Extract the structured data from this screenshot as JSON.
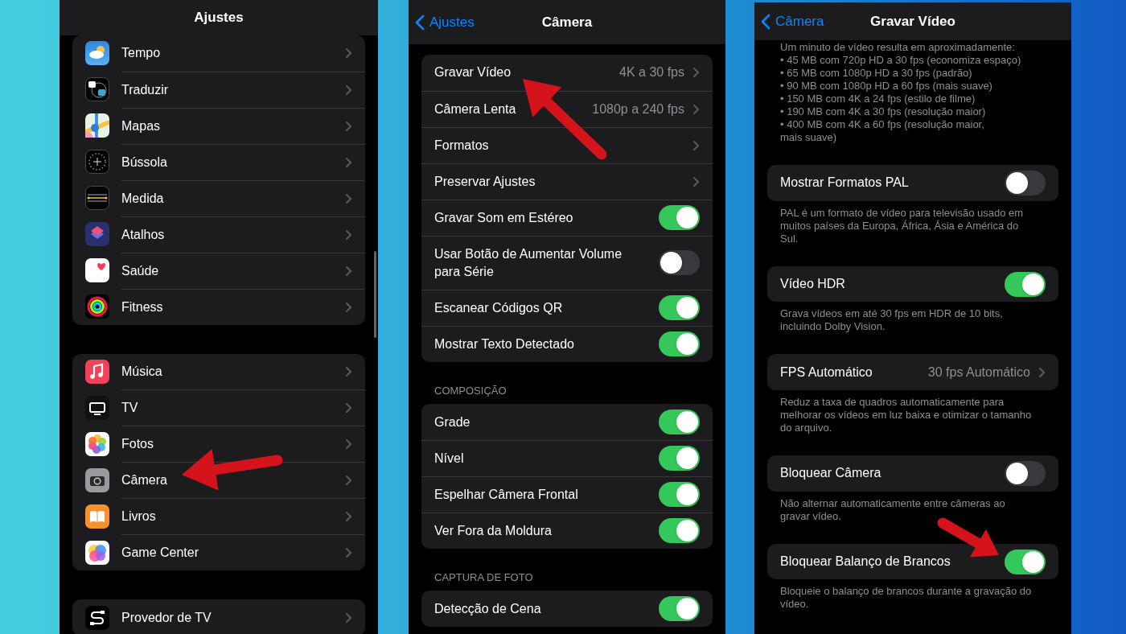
{
  "panels": [
    {
      "title": "Ajustes",
      "groups": [
        {
          "items": [
            {
              "kind": "link",
              "label": "Tempo"
            },
            {
              "kind": "link",
              "label": "Traduzir"
            },
            {
              "kind": "link",
              "label": "Mapas"
            },
            {
              "kind": "link",
              "label": "Bússola"
            },
            {
              "kind": "link",
              "label": "Medida"
            },
            {
              "kind": "link",
              "label": "Atalhos"
            },
            {
              "kind": "link",
              "label": "Saúde"
            },
            {
              "kind": "link",
              "label": "Fitness"
            }
          ]
        },
        {
          "items": [
            {
              "kind": "link",
              "label": "Música"
            },
            {
              "kind": "link",
              "label": "TV"
            },
            {
              "kind": "link",
              "label": "Fotos"
            },
            {
              "kind": "link",
              "label": "Câmera"
            },
            {
              "kind": "link",
              "label": "Livros"
            },
            {
              "kind": "link",
              "label": "Game Center"
            }
          ]
        },
        {
          "items": [
            {
              "kind": "link",
              "label": "Provedor de TV"
            }
          ]
        }
      ]
    },
    {
      "back": "Ajustes",
      "title": "Câmera",
      "groups": [
        {
          "items": [
            {
              "kind": "link",
              "label": "Gravar Vídeo",
              "value": "4K a 30 fps"
            },
            {
              "kind": "link",
              "label": "Câmera Lenta",
              "value": "1080p a 240 fps"
            },
            {
              "kind": "link",
              "label": "Formatos"
            },
            {
              "kind": "link",
              "label": "Preservar Ajustes"
            },
            {
              "kind": "toggle",
              "label": "Gravar Som em Estéreo",
              "on": true
            },
            {
              "kind": "toggle",
              "label": "Usar Botão de Aumentar Volume para Série",
              "on": false
            },
            {
              "kind": "toggle",
              "label": "Escanear Códigos QR",
              "on": true
            },
            {
              "kind": "toggle",
              "label": "Mostrar Texto Detectado",
              "on": true
            }
          ]
        },
        {
          "header": "COMPOSIÇÃO",
          "items": [
            {
              "kind": "toggle",
              "label": "Grade",
              "on": true
            },
            {
              "kind": "toggle",
              "label": "Nível",
              "on": true
            },
            {
              "kind": "toggle",
              "label": "Espelhar Câmera Frontal",
              "on": true
            },
            {
              "kind": "toggle",
              "label": "Ver Fora da Moldura",
              "on": true
            }
          ]
        },
        {
          "header": "CAPTURA DE FOTO",
          "items": [
            {
              "kind": "toggle",
              "label": "Detecção de Cena",
              "on": true
            }
          ]
        }
      ]
    },
    {
      "back": "Câmera",
      "title": "Gravar Vídeo",
      "note_lines": [
        "Um minuto de vídeo resulta em aproximadamente:",
        "• 45 MB com 720p HD a 30 fps (economiza espaço)",
        "• 65 MB com 1080p HD a 30 fps (padrão)",
        "• 90 MB com 1080p HD a 60 fps (mais suave)",
        "• 150 MB com 4K a 24 fps (estilo de filme)",
        "• 190 MB com 4K a 30 fps (resolução maior)",
        "• 400 MB com 4K a 60 fps (resolução maior,",
        "mais suave)"
      ],
      "groups": [
        {
          "items": [
            {
              "kind": "toggle",
              "label": "Mostrar Formatos PAL",
              "on": false
            }
          ],
          "footer": "PAL é um formato de vídeo para televisão usado em muitos países da Europa, África, Ásia e América do Sul."
        },
        {
          "items": [
            {
              "kind": "toggle",
              "label": "Vídeo HDR",
              "on": true
            }
          ],
          "footer": "Grava vídeos em até 30 fps em HDR de 10 bits, incluindo Dolby Vision."
        },
        {
          "items": [
            {
              "kind": "link",
              "label": "FPS Automático",
              "value": "30 fps Automático"
            }
          ],
          "footer": "Reduz a taxa de quadros automaticamente para melhorar os vídeos em luz baixa e otimizar o tamanho do arquivo."
        },
        {
          "items": [
            {
              "kind": "toggle",
              "label": "Bloquear Câmera",
              "on": false
            }
          ],
          "footer": "Não alternar automaticamente entre câmeras ao gravar vídeo."
        },
        {
          "items": [
            {
              "kind": "toggle",
              "label": "Bloquear Balanço de Brancos",
              "on": true
            }
          ],
          "footer": "Bloqueie o balanço de brancos durante a gravação do vídeo."
        }
      ]
    }
  ]
}
